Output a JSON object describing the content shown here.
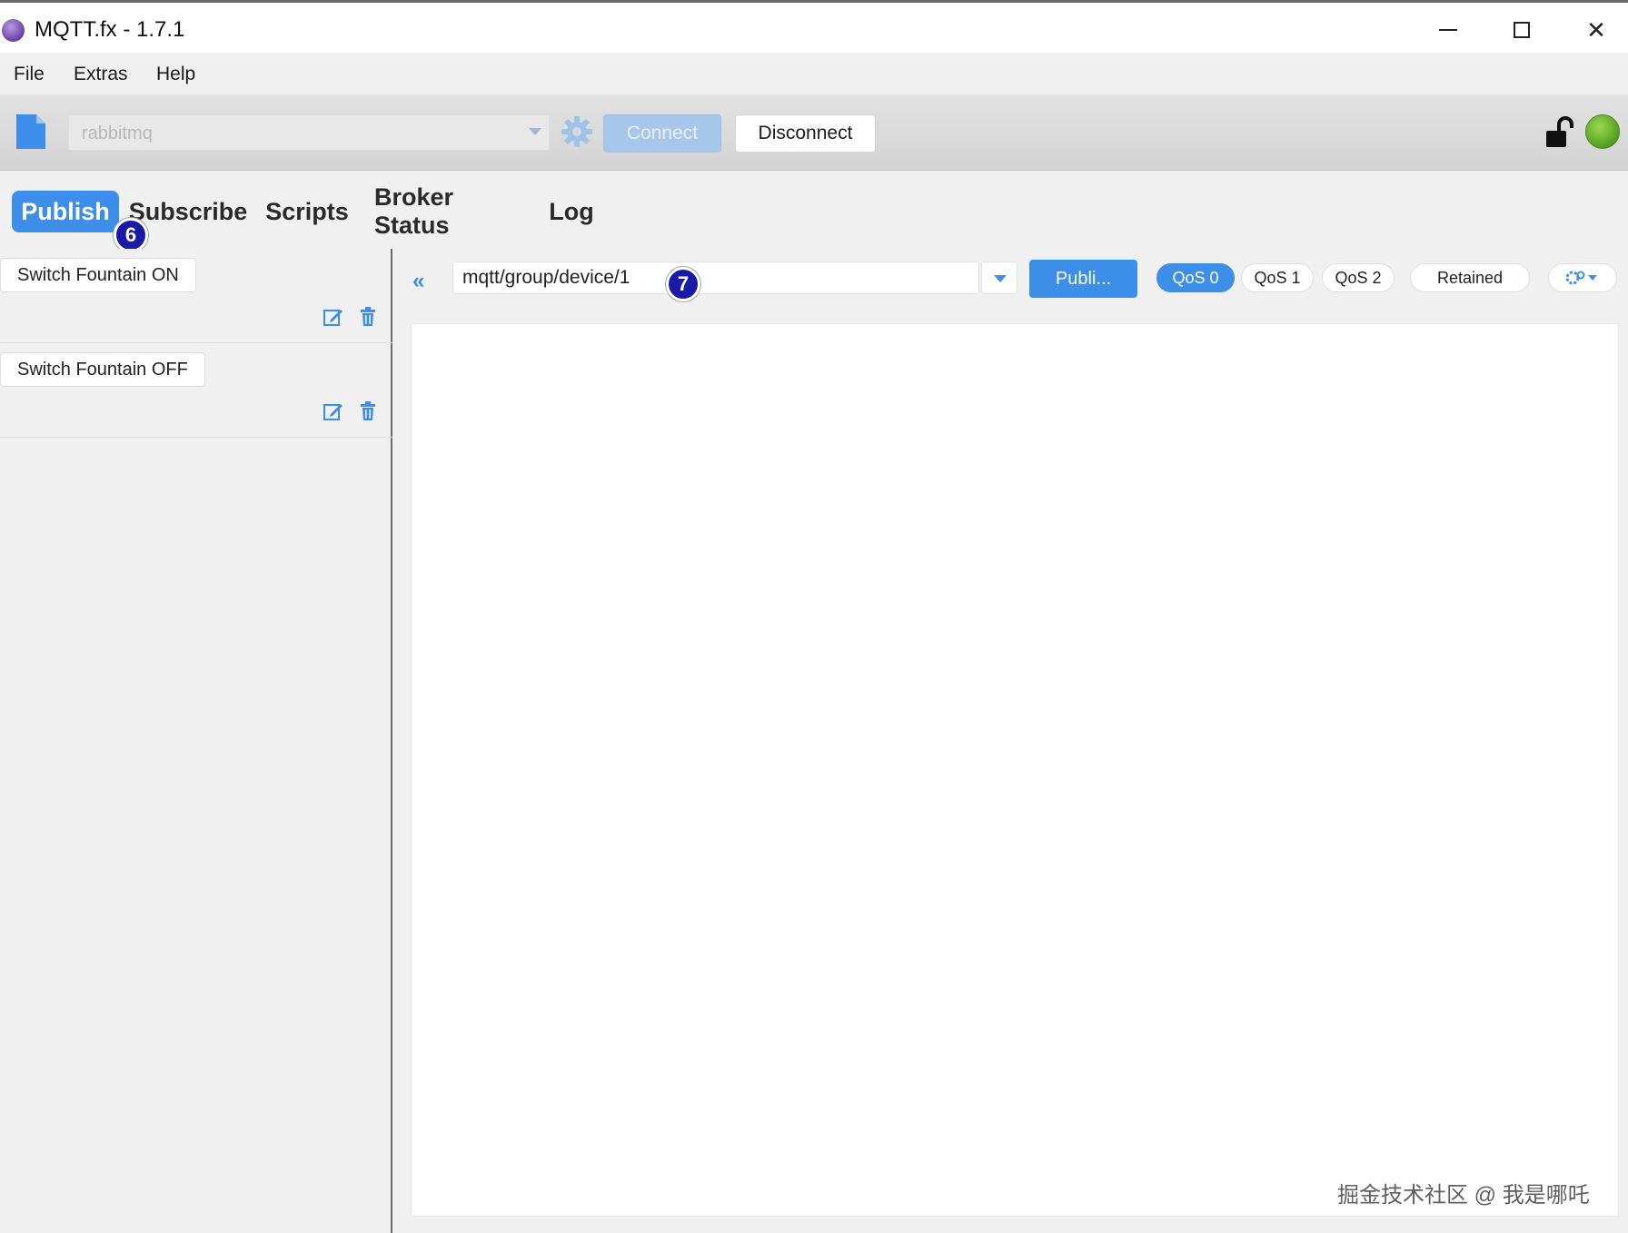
{
  "window": {
    "title": "MQTT.fx - 1.7.1",
    "minimize_glyph": "—",
    "maximize_glyph": "☐",
    "close_glyph": "✕"
  },
  "menu": {
    "items": [
      {
        "label": "File"
      },
      {
        "label": "Extras"
      },
      {
        "label": "Help"
      }
    ]
  },
  "toolbar": {
    "profile_value": "rabbitmq",
    "connect_label": "Connect",
    "disconnect_label": "Disconnect",
    "connection_status_color": "#5fae2a",
    "icons": [
      "new-file-icon",
      "gear-icon",
      "unlock-icon"
    ]
  },
  "tabs": [
    {
      "label": "Publish",
      "active": true
    },
    {
      "label": "Subscribe",
      "active": false
    },
    {
      "label": "Scripts",
      "active": false
    },
    {
      "label": "Broker Status",
      "active": false
    },
    {
      "label": "Log",
      "active": false
    }
  ],
  "annotations": {
    "badge_6": "6",
    "badge_7": "7"
  },
  "scripts": [
    {
      "label": "Switch Fountain ON"
    },
    {
      "label": "Switch Fountain OFF"
    }
  ],
  "publish": {
    "collapse_glyph": "«",
    "topic_value": "mqtt/group/device/1",
    "publish_label": "Publi...",
    "qos_options": [
      {
        "label": "QoS 0",
        "selected": true
      },
      {
        "label": "QoS 1",
        "selected": false
      },
      {
        "label": "QoS 2",
        "selected": false
      }
    ],
    "retained_label": "Retained",
    "payload": ""
  },
  "watermark": "掘金技术社区 @ 我是哪吒",
  "colors": {
    "accent": "#3d8ee8",
    "badge": "#1a1aa8",
    "app_icon": "#7a4fc0"
  }
}
